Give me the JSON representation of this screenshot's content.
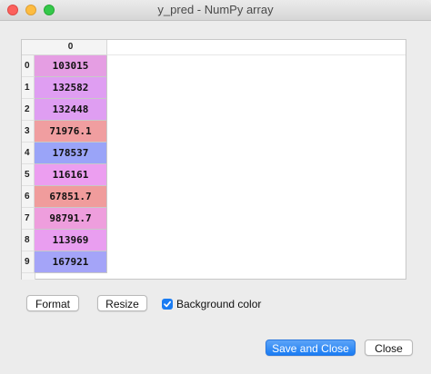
{
  "window": {
    "title": "y_pred - NumPy array",
    "controls": [
      "close",
      "minimize",
      "zoom"
    ]
  },
  "table": {
    "column_headers": [
      "0"
    ],
    "rows": [
      {
        "index": "0",
        "value": "103015",
        "color": "#e59ee3"
      },
      {
        "index": "1",
        "value": "132582",
        "color": "#df9ef2"
      },
      {
        "index": "2",
        "value": "132448",
        "color": "#df9ef2"
      },
      {
        "index": "3",
        "value": "71976.1",
        "color": "#f09ea0"
      },
      {
        "index": "4",
        "value": "178537",
        "color": "#9aa4f8"
      },
      {
        "index": "5",
        "value": "116161",
        "color": "#ec9ef0"
      },
      {
        "index": "6",
        "value": "67851.7",
        "color": "#f09c9c"
      },
      {
        "index": "7",
        "value": "98791.7",
        "color": "#ee9edd"
      },
      {
        "index": "8",
        "value": "113969",
        "color": "#e99ef0"
      },
      {
        "index": "9",
        "value": "167921",
        "color": "#a4a4f8"
      }
    ]
  },
  "controls": {
    "format_label": "Format",
    "resize_label": "Resize",
    "background_color_label": "Background color",
    "background_color_checked": true
  },
  "footer": {
    "save_close_label": "Save and Close",
    "close_label": "Close"
  }
}
